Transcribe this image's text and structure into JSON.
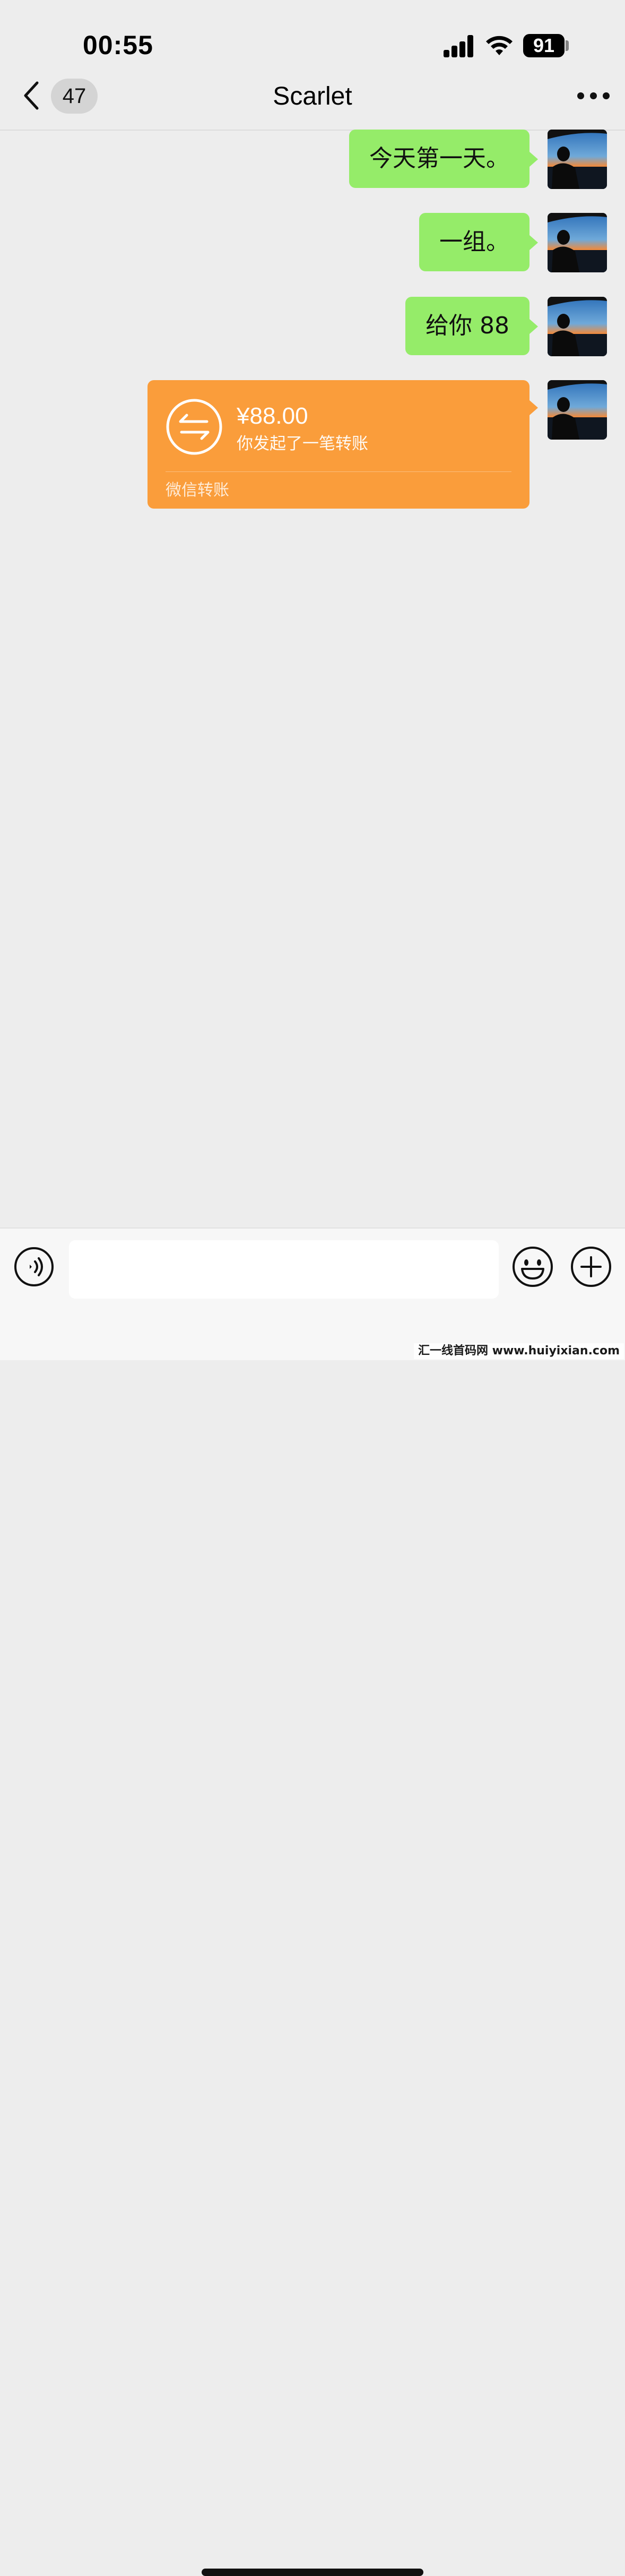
{
  "status_bar": {
    "time": "00:55",
    "battery": "91"
  },
  "nav": {
    "unread_count": "47",
    "title": "Scarlet"
  },
  "messages": [
    {
      "text": "今天第一天。"
    },
    {
      "text": "一组。"
    },
    {
      "text": "给你 88"
    }
  ],
  "transfer": {
    "amount": "¥88.00",
    "description": "你发起了一笔转账",
    "footer": "微信转账",
    "color": "#fa9d3b"
  },
  "input": {
    "value": ""
  },
  "watermark": "汇一线首码网 www.huiyixian.com",
  "colors": {
    "outgoing_bubble": "#95ec69",
    "background": "#ededed"
  },
  "icons": {
    "back": "chevron-left-icon",
    "more": "more-dots-icon",
    "voice": "voice-icon",
    "emoji": "emoji-icon",
    "plus": "plus-icon",
    "transfer": "transfer-arrows-icon"
  }
}
